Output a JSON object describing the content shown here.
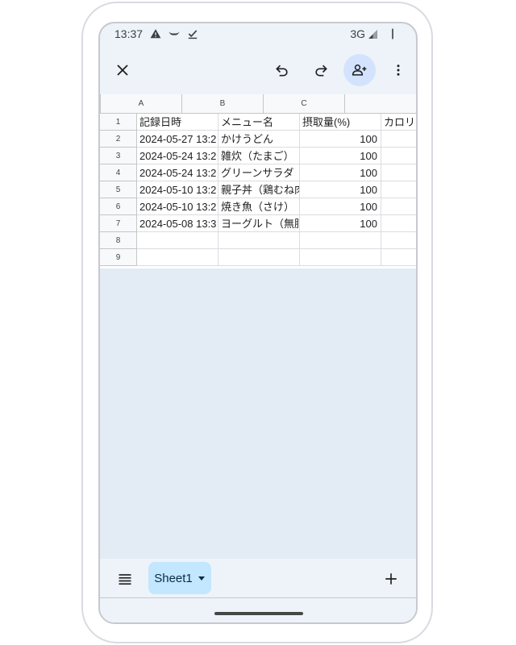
{
  "status_bar": {
    "time": "13:37",
    "network": "3G",
    "icons": [
      "alert-icon",
      "wifi-wings-icon",
      "download-check-icon",
      "signal-icon",
      "battery-icon"
    ]
  },
  "toolbar": {
    "icons": [
      "close-icon",
      "undo-icon",
      "redo-icon",
      "add-person-icon",
      "more-vert-icon"
    ]
  },
  "sheet": {
    "columns": [
      "A",
      "B",
      "C"
    ],
    "rows": [
      {
        "num": "1",
        "a": "記録日時",
        "b": "メニュー名",
        "c": "摂取量(%)",
        "d": "カロリ"
      },
      {
        "num": "2",
        "a": "2024-05-27 13:2",
        "b": "かけうどん",
        "c": "100",
        "d": ""
      },
      {
        "num": "3",
        "a": "2024-05-24 13:2",
        "b": "雑炊（たまご）",
        "c": "100",
        "d": ""
      },
      {
        "num": "4",
        "a": "2024-05-24 13:2",
        "b": "グリーンサラダ",
        "c": "100",
        "d": ""
      },
      {
        "num": "5",
        "a": "2024-05-10 13:2",
        "b": "親子丼（鶏むね肉",
        "c": "100",
        "d": ""
      },
      {
        "num": "6",
        "a": "2024-05-10 13:2",
        "b": "焼き魚（さけ）",
        "c": "100",
        "d": ""
      },
      {
        "num": "7",
        "a": "2024-05-08 13:3",
        "b": "ヨーグルト（無脂",
        "c": "100",
        "d": ""
      },
      {
        "num": "8",
        "a": "",
        "b": "",
        "c": "",
        "d": ""
      },
      {
        "num": "9",
        "a": "",
        "b": "",
        "c": "",
        "d": ""
      }
    ]
  },
  "bottom_bar": {
    "sheet_tab_label": "Sheet1",
    "icons": [
      "sheets-list-icon",
      "dropdown-arrow-icon",
      "add-sheet-icon"
    ]
  },
  "colors": {
    "accent": "#c2e7ff",
    "share_button_bg": "#d3e3fd",
    "background": "#eef3fa",
    "grid_empty": "#e3ebf4"
  }
}
